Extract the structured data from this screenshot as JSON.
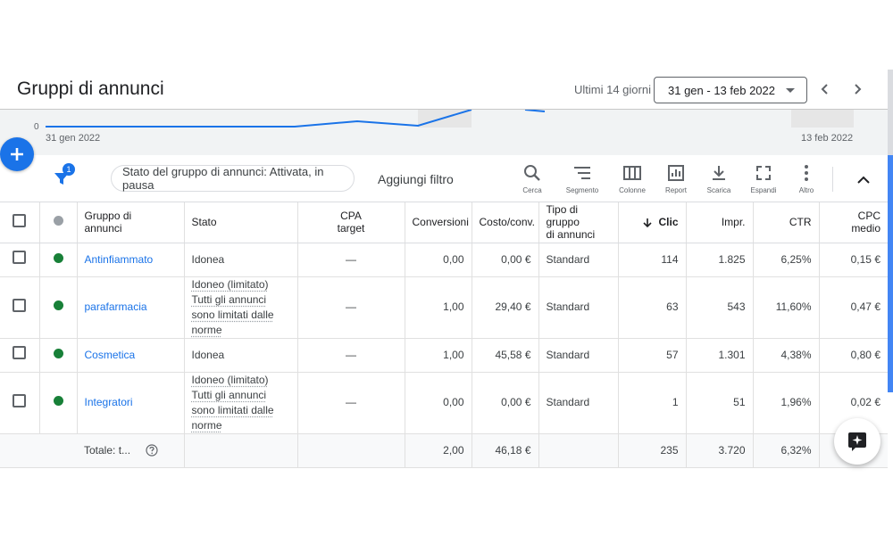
{
  "header": {
    "title": "Gruppi di annunci",
    "range_label": "Ultimi 14 giorni",
    "date_range": "31 gen - 13 feb 2022"
  },
  "chart": {
    "zero_label": "0",
    "start_date": "31 gen 2022",
    "end_date": "13 feb 2022",
    "line_color": "#1a73e8"
  },
  "toolbar": {
    "filter_count": "1",
    "filter_chip": "Stato del gruppo di annunci: Attivata, in pausa",
    "add_filter": "Aggiungi filtro",
    "tools": [
      {
        "label": "Cerca",
        "icon": "search-icon"
      },
      {
        "label": "Segmento",
        "icon": "segment-icon"
      },
      {
        "label": "Colonne",
        "icon": "columns-icon"
      },
      {
        "label": "Report",
        "icon": "report-icon"
      },
      {
        "label": "Scarica",
        "icon": "download-icon"
      },
      {
        "label": "Espandi",
        "icon": "expand-icon"
      },
      {
        "label": "Altro",
        "icon": "more-vert-icon"
      }
    ]
  },
  "table": {
    "columns": {
      "group_line1": "Gruppo di",
      "group_line2": "annunci",
      "status": "Stato",
      "cpa_line1": "CPA",
      "cpa_line2": "target",
      "conversions": "Conversioni",
      "cost_conv": "Costo/conv.",
      "type_line1": "Tipo di gruppo",
      "type_line2": "di annunci",
      "clicks": "Clic",
      "impr": "Impr.",
      "ctr": "CTR",
      "cpc": "CPC medio"
    },
    "rows": [
      {
        "name": "Antinfiammato",
        "status": "Idonea",
        "status2": "",
        "cpa": "—",
        "conversions": "0,00",
        "cost_conv": "0,00 €",
        "type": "Standard",
        "clicks": "114",
        "impr": "1.825",
        "ctr": "6,25%",
        "cpc": "0,15 €"
      },
      {
        "name": "parafarmacia",
        "status": "Idoneo (limitato)",
        "status2": "Tutti gli annunci sono limitati dalle norme",
        "cpa": "—",
        "conversions": "1,00",
        "cost_conv": "29,40 €",
        "type": "Standard",
        "clicks": "63",
        "impr": "543",
        "ctr": "11,60%",
        "cpc": "0,47 €"
      },
      {
        "name": "Cosmetica",
        "status": "Idonea",
        "status2": "",
        "cpa": "—",
        "conversions": "1,00",
        "cost_conv": "45,58 €",
        "type": "Standard",
        "clicks": "57",
        "impr": "1.301",
        "ctr": "4,38%",
        "cpc": "0,80 €"
      },
      {
        "name": "Integratori",
        "status": "Idoneo (limitato)",
        "status2": "Tutti gli annunci sono limitati dalle norme",
        "cpa": "—",
        "conversions": "0,00",
        "cost_conv": "0,00 €",
        "type": "Standard",
        "clicks": "1",
        "impr": "51",
        "ctr": "1,96%",
        "cpc": "0,02 €"
      }
    ],
    "total": {
      "label": "Totale: t...",
      "conversions": "2,00",
      "cost_conv": "46,18 €",
      "clicks": "235",
      "impr": "3.720",
      "ctr": "6,32%"
    }
  },
  "colors": {
    "accent": "#1a73e8",
    "enabled_green": "#188038"
  }
}
